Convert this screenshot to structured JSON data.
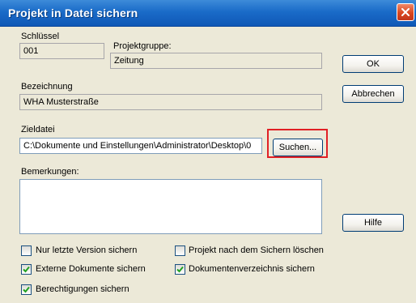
{
  "dialog": {
    "title": "Projekt in Datei sichern"
  },
  "fields": {
    "schluessel_label": "Schlüssel",
    "schluessel_value": "001",
    "projektgruppe_label": "Projektgruppe:",
    "projektgruppe_value": "Zeitung",
    "bezeichnung_label": "Bezeichnung",
    "bezeichnung_value": "WHA Musterstraße",
    "zieldatei_label": "Zieldatei",
    "zieldatei_value": "C:\\Dokumente und Einstellungen\\Administrator\\Desktop\\0",
    "bemerkungen_label": "Bemerkungen:",
    "bemerkungen_value": ""
  },
  "buttons": {
    "ok": "OK",
    "abbrechen": "Abbrechen",
    "suchen": "Suchen...",
    "hilfe": "Hilfe"
  },
  "checkboxes": {
    "nur_letzte_version": {
      "label": "Nur letzte Version sichern",
      "checked": false
    },
    "projekt_loeschen": {
      "label": "Projekt nach dem Sichern löschen",
      "checked": false
    },
    "externe_dokumente": {
      "label": "Externe Dokumente sichern",
      "checked": true
    },
    "dokumentenverzeichnis": {
      "label": "Dokumentenverzeichnis sichern",
      "checked": true
    },
    "berechtigungen": {
      "label": "Berechtigungen sichern",
      "checked": true
    }
  },
  "colors": {
    "titlebar": "#1a6bc8",
    "dialog_bg": "#ece9d8",
    "highlight": "#e12025",
    "check": "#21a121"
  },
  "icons": {
    "close": "close-icon",
    "check": "checkmark-icon"
  }
}
